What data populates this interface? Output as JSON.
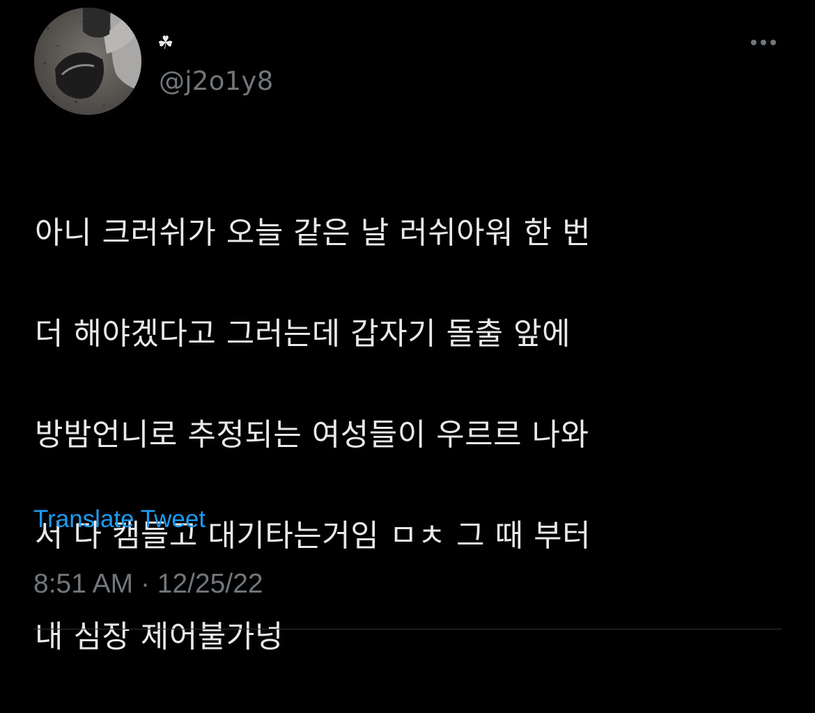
{
  "tweet": {
    "author": {
      "display_name": "☘",
      "handle": "@j2o1y8"
    },
    "text_lines": [
      "아니 크러쉬가 오늘 같은 날 러쉬아워 한 번",
      "더 해야겠다고 그러는데 갑자기 돌출 앞에",
      "방밤언니로 추정되는 여성들이 우르르 나와",
      "서 다 캠들고 대기타는거임 ㅁㅊ 그 때 부터",
      "내 심장 제어불가넝"
    ],
    "translate_label": "Translate Tweet",
    "time": "8:51 AM",
    "separator": "·",
    "date": "12/25/22"
  },
  "icons": {
    "more": "more-horizontal-icon"
  },
  "colors": {
    "background": "#000000",
    "primary_text": "#e7e9ea",
    "secondary_text": "#71767b",
    "link": "#1d9bf0",
    "divider": "#2f3336"
  }
}
